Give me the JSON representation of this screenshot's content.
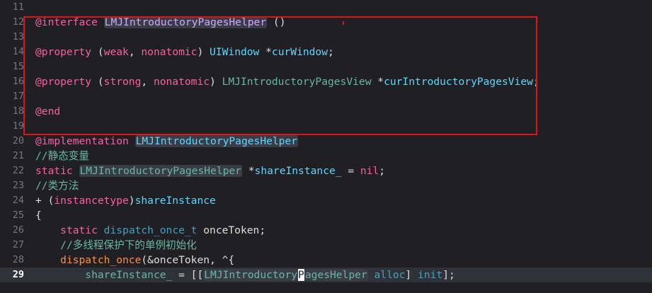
{
  "editor": {
    "lines": [
      {
        "num": "11",
        "tokens": []
      },
      {
        "num": "12",
        "tokens": [
          {
            "t": "@interface",
            "c": "kw"
          },
          {
            "t": " "
          },
          {
            "t": "LMJIntroductoryPagesHelper",
            "c": "cls sym"
          },
          {
            "t": " ()"
          }
        ]
      },
      {
        "num": "13",
        "tokens": []
      },
      {
        "num": "14",
        "tokens": [
          {
            "t": "@property",
            "c": "kw"
          },
          {
            "t": " ("
          },
          {
            "t": "weak",
            "c": "kw"
          },
          {
            "t": ", "
          },
          {
            "t": "nonatomic",
            "c": "kw"
          },
          {
            "t": ") "
          },
          {
            "t": "UIWindow",
            "c": "typ"
          },
          {
            "t": " *"
          },
          {
            "t": "curWindow",
            "c": "typ"
          },
          {
            "t": ";"
          }
        ]
      },
      {
        "num": "15",
        "tokens": []
      },
      {
        "num": "16",
        "tokens": [
          {
            "t": "@property",
            "c": "kw"
          },
          {
            "t": " ("
          },
          {
            "t": "strong",
            "c": "kw"
          },
          {
            "t": ", "
          },
          {
            "t": "nonatomic",
            "c": "kw"
          },
          {
            "t": ") "
          },
          {
            "t": "LMJIntroductoryPagesView",
            "c": "fn"
          },
          {
            "t": " *"
          },
          {
            "t": "curIntroductoryPagesView",
            "c": "typ"
          },
          {
            "t": ";"
          }
        ]
      },
      {
        "num": "17",
        "tokens": []
      },
      {
        "num": "18",
        "tokens": [
          {
            "t": "@end",
            "c": "kw"
          }
        ]
      },
      {
        "num": "19",
        "tokens": []
      },
      {
        "num": "20",
        "tokens": [
          {
            "t": "@implementation",
            "c": "kw"
          },
          {
            "t": " "
          },
          {
            "t": "LMJIntroductoryPagesHelper",
            "c": "typ sym"
          }
        ]
      },
      {
        "num": "21",
        "tokens": [
          {
            "t": "//静态变量",
            "c": "fn"
          }
        ]
      },
      {
        "num": "22",
        "tokens": [
          {
            "t": "static",
            "c": "kw"
          },
          {
            "t": " "
          },
          {
            "t": "LMJIntroductoryPagesHelper",
            "c": "fn sym"
          },
          {
            "t": " *"
          },
          {
            "t": "shareInstance_",
            "c": "typ"
          },
          {
            "t": " = "
          },
          {
            "t": "nil",
            "c": "kw"
          },
          {
            "t": ";"
          }
        ]
      },
      {
        "num": "23",
        "tokens": [
          {
            "t": "//类方法",
            "c": "fn"
          }
        ]
      },
      {
        "num": "24",
        "tokens": [
          {
            "t": "+ ("
          },
          {
            "t": "instancetype",
            "c": "kw"
          },
          {
            "t": ")"
          },
          {
            "t": "shareInstance",
            "c": "typ"
          }
        ]
      },
      {
        "num": "25",
        "tokens": [
          {
            "t": "{"
          }
        ]
      },
      {
        "num": "26",
        "tokens": [
          {
            "t": "    "
          },
          {
            "t": "static",
            "c": "kw"
          },
          {
            "t": " "
          },
          {
            "t": "dispatch_once_t",
            "c": "prop"
          },
          {
            "t": " onceToken;"
          }
        ]
      },
      {
        "num": "27",
        "tokens": [
          {
            "t": "    "
          },
          {
            "t": "//多线程保护下的单例初始化",
            "c": "fn"
          }
        ]
      },
      {
        "num": "28",
        "tokens": [
          {
            "t": "    "
          },
          {
            "t": "dispatch_once",
            "c": "dir"
          },
          {
            "t": "(&onceToken, ^{"
          }
        ]
      },
      {
        "num": "29",
        "current": true,
        "tokens": [
          {
            "t": "        "
          },
          {
            "t": "shareInstance_",
            "c": "fn"
          },
          {
            "t": " = [["
          },
          {
            "t": "LMJIntroductory",
            "c": "fn sym"
          },
          {
            "t": "P",
            "c": "caret"
          },
          {
            "t": "agesHelper",
            "c": "fn sym"
          },
          {
            "t": " "
          },
          {
            "t": "alloc",
            "c": "prop"
          },
          {
            "t": "] "
          },
          {
            "t": "init",
            "c": "prop"
          },
          {
            "t": "];"
          }
        ]
      }
    ]
  },
  "annotation": {
    "box_color": "#e0121c"
  }
}
